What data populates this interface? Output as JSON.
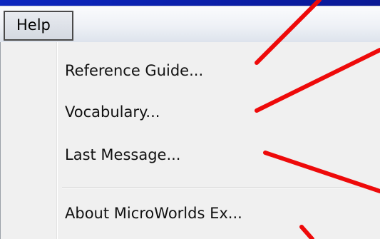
{
  "menubar": {
    "help_label": "Help"
  },
  "help_menu": {
    "items": [
      {
        "label": "Reference Guide..."
      },
      {
        "label": "Vocabulary..."
      },
      {
        "label": "Last Message..."
      },
      {
        "label": "About MicroWorlds Ex..."
      }
    ]
  },
  "colors": {
    "background": "#0a1fa8",
    "arrow": "#ee0a0a",
    "menu_bg": "#f0f0f0",
    "menubar_bg": "#eef1f6"
  },
  "annotations": {
    "arrow_count": 5
  }
}
